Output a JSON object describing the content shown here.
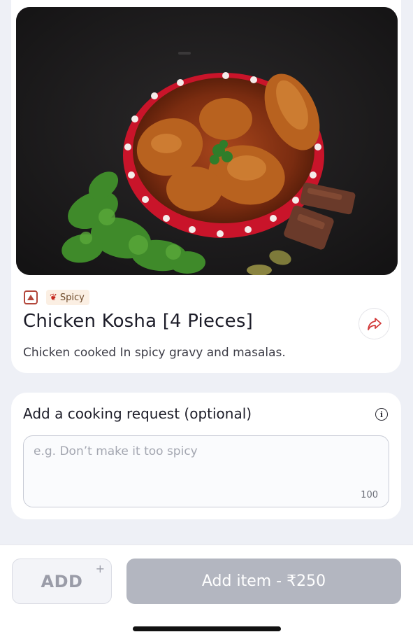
{
  "item": {
    "tags": {
      "diet_mark": "non-veg-mark-icon",
      "spicy_icon": "chili-icon",
      "spicy_label": "Spicy"
    },
    "title": "Chicken Kosha [4 Pieces]",
    "description": "Chicken cooked In spicy gravy and masalas.",
    "share_icon": "share-arrow-icon"
  },
  "cooking_request": {
    "title": "Add a cooking request (optional)",
    "info_icon": "info-icon",
    "placeholder": "e.g. Don’t make it too spicy",
    "char_limit": "100"
  },
  "actions": {
    "add_label": "ADD",
    "add_plus": "+",
    "add_item_label": "Add item - ₹250"
  },
  "colors": {
    "accent": "#b3473b",
    "button_disabled": "#b3b6c0",
    "page_bg": "#eef0f6"
  }
}
